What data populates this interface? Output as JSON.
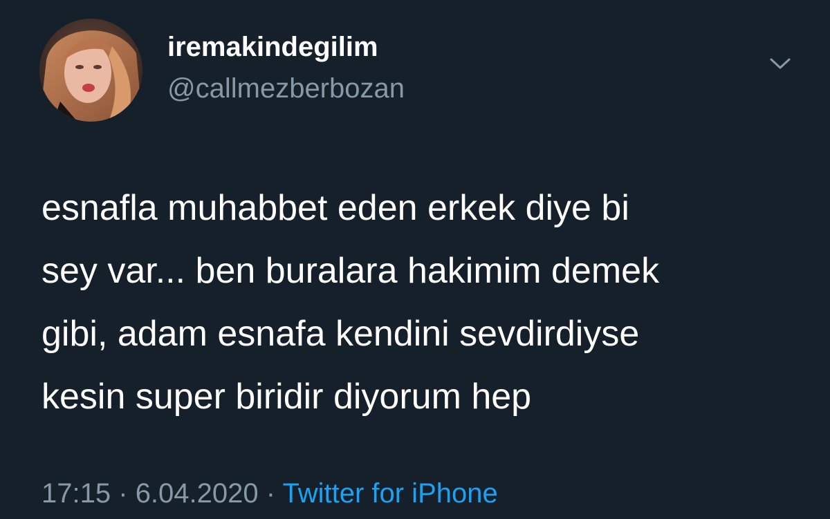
{
  "tweet": {
    "author": {
      "display_name": "iremakindegilim",
      "handle": "@callmezberbozan",
      "avatar_icon": "profile-photo"
    },
    "menu_icon": "chevron-down-icon",
    "text_lines": [
      "esnafla muhabbet eden erkek diye bi",
      "sey var... ben buralara hakimim demek",
      "gibi, adam esnafa kendini sevdirdiyse",
      "kesin super biridir diyorum hep"
    ],
    "meta": {
      "time": "17:15",
      "separator": "·",
      "date": "6.04.2020",
      "source": "Twitter for iPhone"
    }
  },
  "colors": {
    "background": "#15202b",
    "text_primary": "#ffffff",
    "text_secondary": "#8899a6",
    "accent": "#1da1f2"
  }
}
